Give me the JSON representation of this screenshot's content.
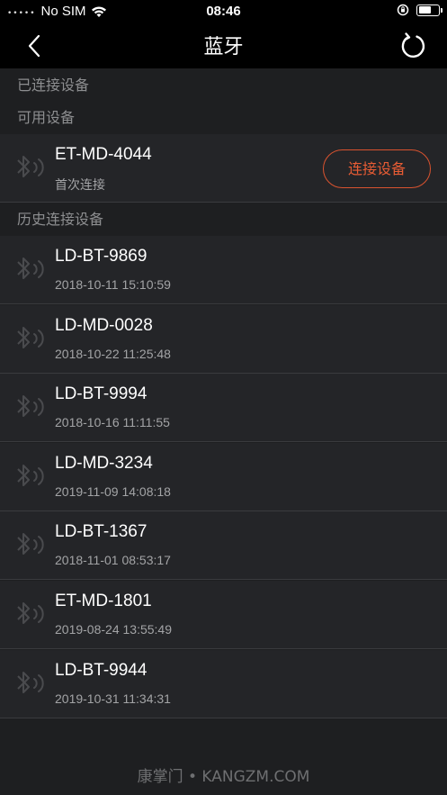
{
  "status_bar": {
    "dots": "•••••",
    "carrier": "No SIM",
    "time": "08:46"
  },
  "nav": {
    "title": "蓝牙"
  },
  "sections": {
    "connected": "已连接设备",
    "available": "可用设备",
    "history": "历史连接设备"
  },
  "available_device": {
    "name": "ET-MD-4044",
    "subtitle": "首次连接",
    "button_label": "连接设备"
  },
  "history_devices": [
    {
      "name": "LD-BT-9869",
      "timestamp": "2018-10-11 15:10:59"
    },
    {
      "name": "LD-MD-0028",
      "timestamp": "2018-10-22 11:25:48"
    },
    {
      "name": "LD-BT-9994",
      "timestamp": "2018-10-16 11:11:55"
    },
    {
      "name": "LD-MD-3234",
      "timestamp": "2019-11-09 14:08:18"
    },
    {
      "name": "LD-BT-1367",
      "timestamp": "2018-11-01 08:53:17"
    },
    {
      "name": "ET-MD-1801",
      "timestamp": "2019-08-24 13:55:49"
    },
    {
      "name": "LD-BT-9944",
      "timestamp": "2019-10-31 11:34:31"
    }
  ],
  "footer": "康掌门 • KANGZM.COM",
  "icons": {
    "back": "chevron-left-icon",
    "refresh": "refresh-icon",
    "bluetooth": "bluetooth-icon"
  },
  "colors": {
    "accent": "#e85c34",
    "background": "#1e1f21",
    "row": "#242528"
  }
}
